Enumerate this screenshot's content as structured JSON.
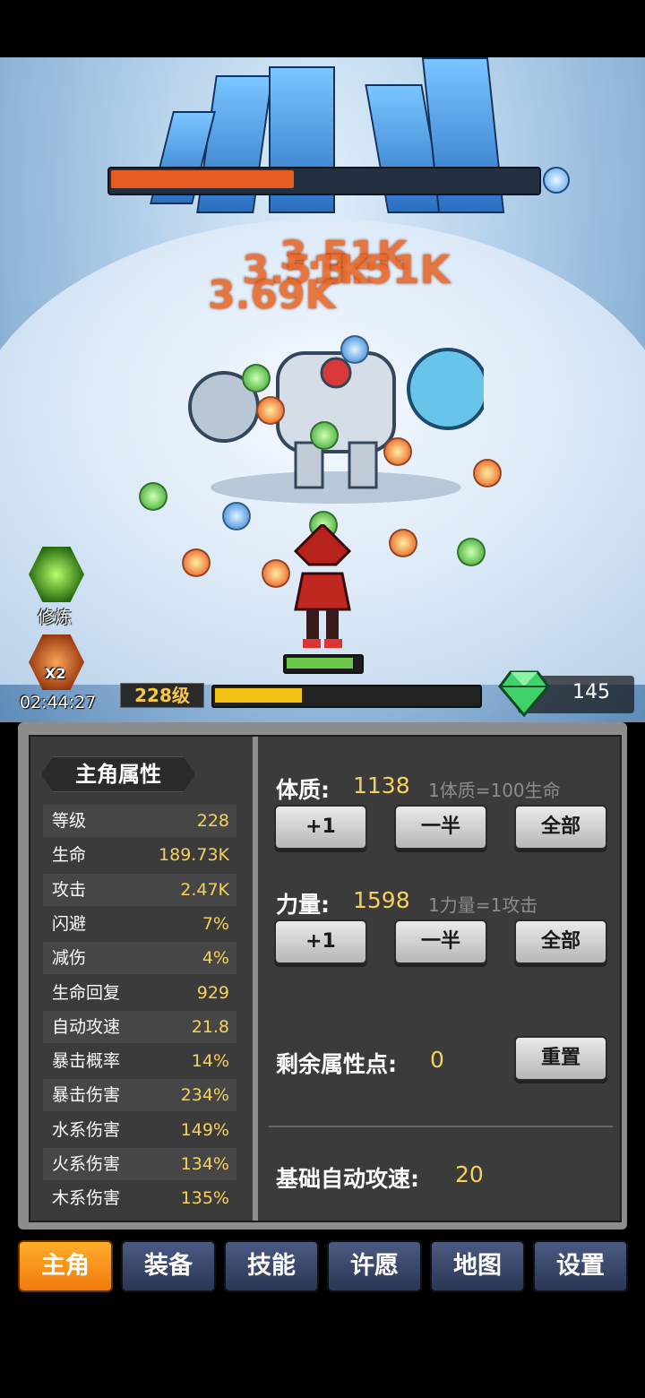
{
  "battle": {
    "damage_numbers": [
      "3.69K",
      "3.51K",
      "3.51K",
      "3.51K"
    ],
    "hero_skill_label": "修炼",
    "boost_label": "X2",
    "boost_timer": "02:44:27",
    "level_tag": "228级",
    "gem_count": "145",
    "boss_health_fraction": 0.43,
    "xp_fraction": 0.33,
    "hero_health_fraction": 0.92
  },
  "stats_panel": {
    "title": "主角属性",
    "rows": [
      {
        "name": "等级",
        "value": "228"
      },
      {
        "name": "生命",
        "value": "189.73K"
      },
      {
        "name": "攻击",
        "value": "2.47K"
      },
      {
        "name": "闪避",
        "value": "7%"
      },
      {
        "name": "减伤",
        "value": "4%"
      },
      {
        "name": "生命回复",
        "value": "929"
      },
      {
        "name": "自动攻速",
        "value": "21.8"
      },
      {
        "name": "暴击概率",
        "value": "14%"
      },
      {
        "name": "暴击伤害",
        "value": "234%"
      },
      {
        "name": "水系伤害",
        "value": "149%"
      },
      {
        "name": "火系伤害",
        "value": "134%"
      },
      {
        "name": "木系伤害",
        "value": "135%"
      }
    ]
  },
  "attributes": {
    "constitution": {
      "label": "体质:",
      "value": "1138",
      "hint": "1体质=100生命"
    },
    "strength": {
      "label": "力量:",
      "value": "1598",
      "hint": "1力量=1攻击"
    },
    "btn_plus_one": "+1",
    "btn_half": "一半",
    "btn_all": "全部",
    "remaining_label": "剩余属性点:",
    "remaining_value": "0",
    "reset_label": "重置",
    "base_speed_label": "基础自动攻速:",
    "base_speed_value": "20"
  },
  "tabs": [
    "主角",
    "装备",
    "技能",
    "许愿",
    "地图",
    "设置"
  ],
  "colors": {
    "accent": "#f5d25a",
    "tab_active": "#f59a1a",
    "boss_bar": "#e55b22",
    "xp": "#f2c316"
  }
}
